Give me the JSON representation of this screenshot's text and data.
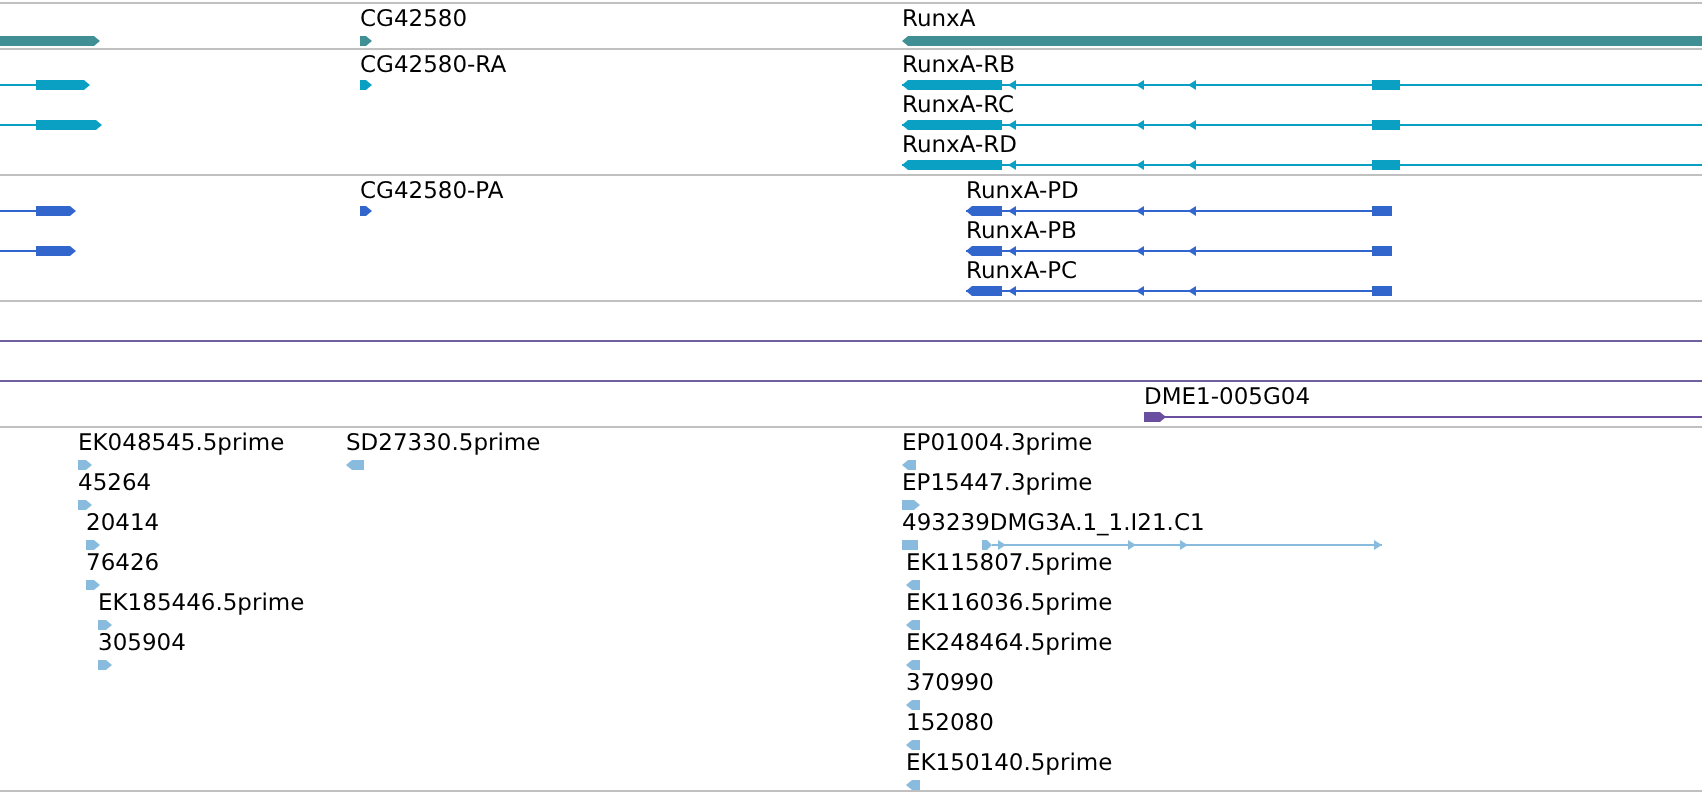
{
  "tracks": [
    {
      "color": "#3f8f94",
      "features": [
        {
          "reverse": false
        },
        {
          "label": "CG42580",
          "reverse": false
        },
        {
          "label": "RunxA",
          "reverse": true
        }
      ]
    },
    {
      "color": "#0aa0c4",
      "features": [
        {
          "reverse": false
        },
        {
          "reverse": false
        },
        {
          "label": "CG42580-RA",
          "reverse": false
        },
        {
          "label": "RunxA-RB",
          "reverse": true
        },
        {
          "label": "RunxA-RC",
          "reverse": true
        },
        {
          "label": "RunxA-RD",
          "reverse": true
        }
      ]
    },
    {
      "color": "#3366cc",
      "features": [
        {
          "reverse": false
        },
        {
          "reverse": false
        },
        {
          "label": "CG42580-PA",
          "reverse": false
        },
        {
          "label": "RunxA-PD",
          "reverse": true
        },
        {
          "label": "RunxA-PB",
          "reverse": true
        },
        {
          "label": "RunxA-PC",
          "reverse": true
        }
      ]
    },
    {
      "color": "#6a4fa0",
      "features": [
        {
          "label": "DME1-005G04",
          "reverse": false
        }
      ]
    },
    {
      "color": "#88bbdd",
      "features": [
        {
          "label": "EK048545.5prime",
          "reverse": false
        },
        {
          "label": "45264",
          "reverse": false
        },
        {
          "label": "20414",
          "reverse": false
        },
        {
          "label": "76426",
          "reverse": false
        },
        {
          "label": "EK185446.5prime",
          "reverse": false
        },
        {
          "label": "305904",
          "reverse": false
        },
        {
          "label": "SD27330.5prime",
          "reverse": true
        },
        {
          "label": "EP01004.3prime",
          "reverse": true
        },
        {
          "label": "EP15447.3prime",
          "reverse": false
        },
        {
          "label": "493239DMG3A.1_1.I21.C1",
          "reverse": false
        },
        {
          "label": "EK115807.5prime",
          "reverse": true
        },
        {
          "label": "EK116036.5prime",
          "reverse": true
        },
        {
          "label": "EK248464.5prime",
          "reverse": true
        },
        {
          "label": "370990",
          "reverse": true
        },
        {
          "label": "152080",
          "reverse": true
        },
        {
          "label": "EK150140.5prime",
          "reverse": true
        }
      ]
    }
  ]
}
